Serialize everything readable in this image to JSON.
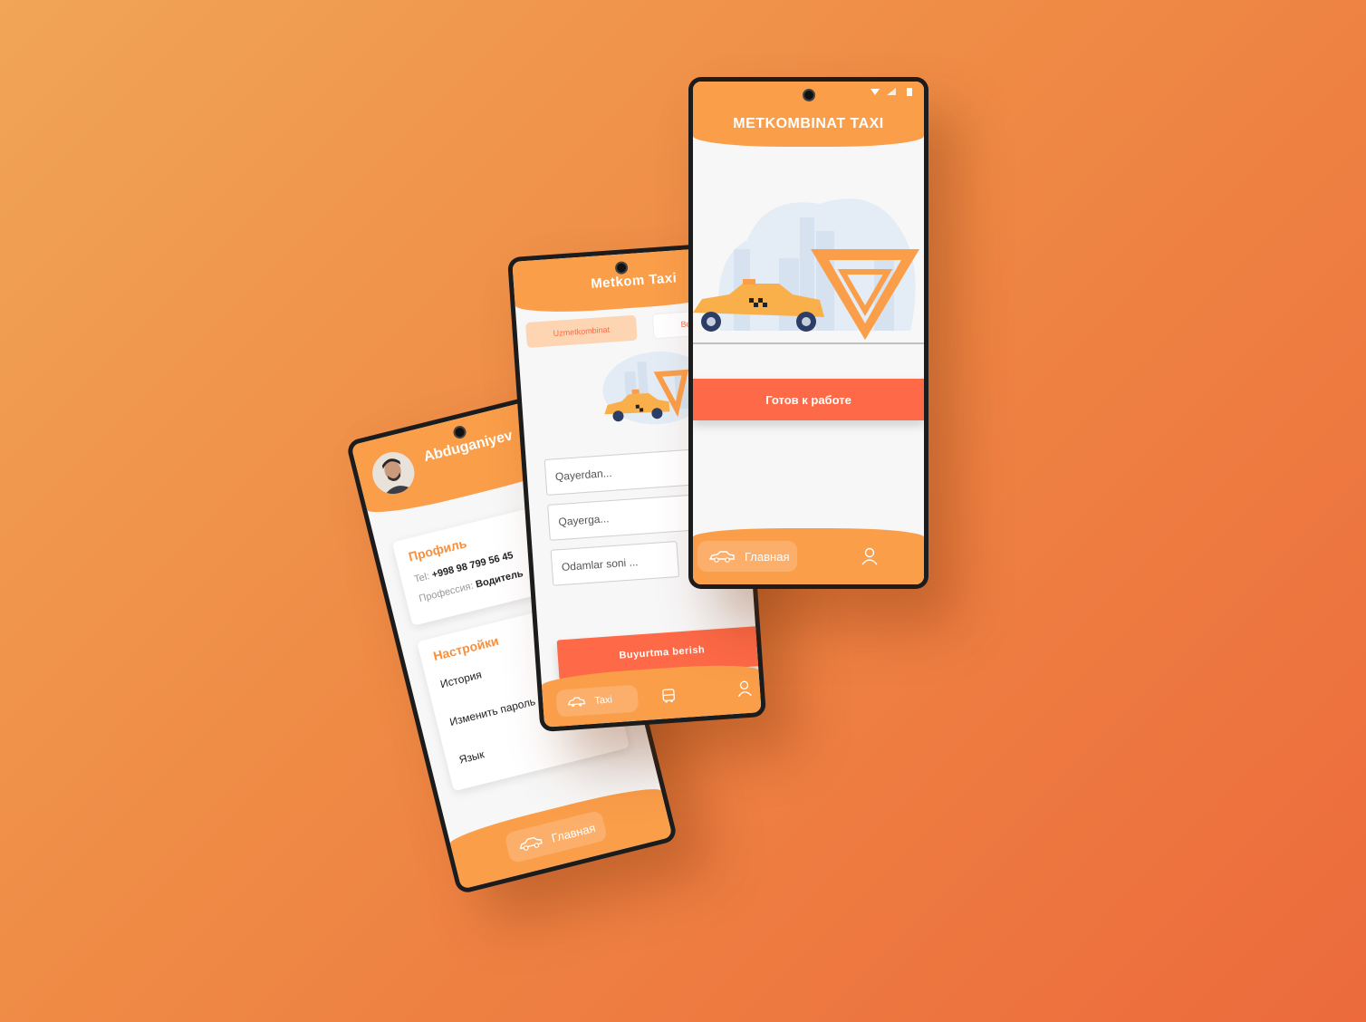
{
  "profile_screen": {
    "user_name": "Abduganiyev",
    "profile_heading": "Профиль",
    "tel_label": "Tel:",
    "tel_value": "+998 98 799 56 45",
    "profession_label": "Профессия:",
    "profession_value": "Водитель",
    "settings_heading": "Настройки",
    "settings_items": [
      "История",
      "Изменить пароль",
      "Язык"
    ],
    "nav_home_label": "Главная"
  },
  "order_screen": {
    "title": "Metkom Taxi",
    "tabs": [
      "Uzmetkombinat",
      "Boshqa"
    ],
    "from_placeholder": "Qayerdan...",
    "to_placeholder": "Qayerga...",
    "people_placeholder": "Odamlar soni ...",
    "submit_label": "Buyurtma berish",
    "nav_taxi_label": "Taxi"
  },
  "driver_screen": {
    "title": "METKOMBINAT TAXI",
    "ready_button": "Готов к работе",
    "nav_home_label": "Главная"
  },
  "colors": {
    "header_orange": "#fa9e4a",
    "accent_red": "#fe6947",
    "label_orange": "#fa8f3a"
  },
  "icons": [
    "car-icon",
    "bus-icon",
    "user-icon",
    "avatar",
    "logo-v-icon",
    "wifi-icon",
    "signal-icon",
    "battery-icon"
  ]
}
